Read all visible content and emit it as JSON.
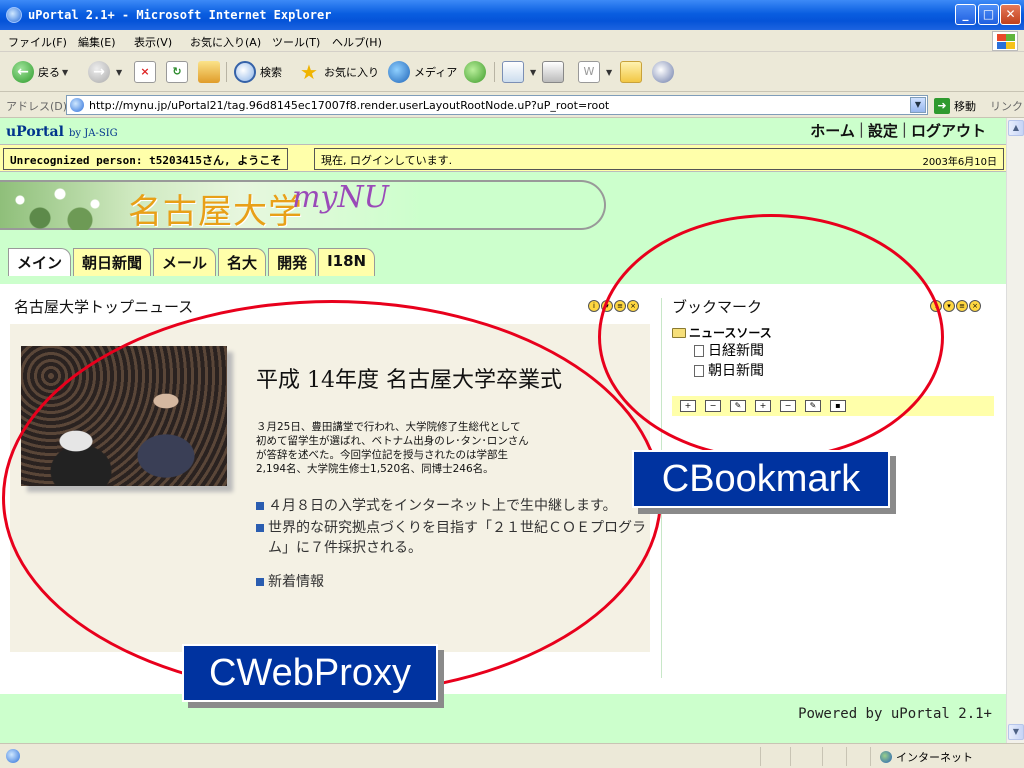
{
  "window": {
    "title": "uPortal 2.1+ - Microsoft Internet Explorer",
    "minimize": "_",
    "maximize": "□",
    "close": "✕"
  },
  "menu": [
    "ファイル(F)",
    "編集(E)",
    "表示(V)",
    "お気に入り(A)",
    "ツール(T)",
    "ヘルプ(H)"
  ],
  "toolbar": {
    "back": "戻る",
    "search": "検索",
    "favorites": "お気に入り",
    "media": "メディア"
  },
  "address": {
    "label": "アドレス(D)",
    "url": "http://mynu.jp/uPortal21/tag.96d8145ec17007f8.render.userLayoutRootNode.uP?uP_root=root",
    "go": "移動",
    "links": "リンク"
  },
  "portal": {
    "brand": "uPortal",
    "brand_by": "by JA-SIG",
    "links": [
      "ホーム",
      "設定",
      "ログアウト"
    ],
    "welcome": "Unrecognized person: t5203415さん, ようこそ",
    "status": "現在, ログインしています.",
    "date": "2003年6月10日",
    "logo_jp": "名古屋大学",
    "logo_en": "myNU",
    "tabs": [
      "メイン",
      "朝日新聞",
      "メール",
      "名大",
      "開発",
      "I18N"
    ]
  },
  "news": {
    "title": "名古屋大学トップニュース",
    "headline": "平成 14年度 名古屋大学卒業式",
    "body": "３月25日、豊田講堂で行われ、大学院修了生総代として\n初めて留学生が選ばれ、ベトナム出身のレ･タン･ロンさん\nが答辞を述べた。今回学位記を授与されたのは学部生\n2,194名、大学院生修士1,520名、同博士246名。",
    "bullets": [
      "４月８日の入学式をインターネット上で生中継します。",
      "世界的な研究拠点づくりを目指す「２１世紀ＣＯＥプログラム」に７件採択される。",
      "新着情報"
    ]
  },
  "bookmarks": {
    "title": "ブックマーク",
    "folder": "ニュースソース",
    "items": [
      "日経新聞",
      "朝日新聞"
    ]
  },
  "footer": {
    "powered": "Powered by uPortal 2.1+"
  },
  "statusbar": {
    "zone": "インターネット"
  },
  "annotations": {
    "bookmark_label": "CBookmark",
    "webproxy_label": "CWebProxy"
  },
  "colors": {
    "portal_bg": "#ccffcc",
    "yellow": "#ffffaa",
    "callout_bg": "#0033a0",
    "ellipse": "#e8001c"
  }
}
